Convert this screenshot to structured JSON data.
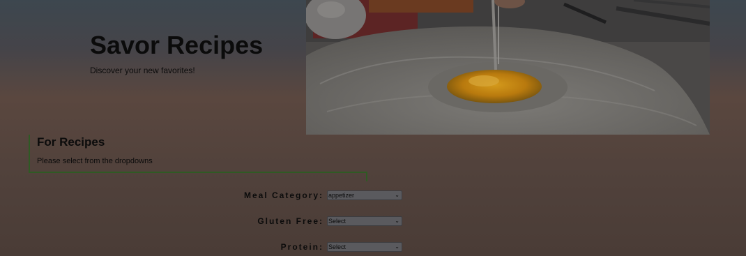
{
  "header": {
    "title": "Savor Recipes",
    "tagline": "Discover your new favorites!"
  },
  "hero_image": {
    "description_icon": "flour-and-egg-photo"
  },
  "recipes_section": {
    "heading": "For Recipes",
    "hint": "Please select from the dropdowns"
  },
  "filters": {
    "meal_category": {
      "label": "Meal Category:",
      "selected": "appetizer"
    },
    "gluten_free": {
      "label": "Gluten Free:",
      "selected": "Select"
    },
    "protein": {
      "label": "Protein:",
      "selected": "Select"
    }
  },
  "colors": {
    "accent_border": "#2f5a24",
    "background_top": "#3d474f",
    "background_bottom": "#4a3c36"
  }
}
